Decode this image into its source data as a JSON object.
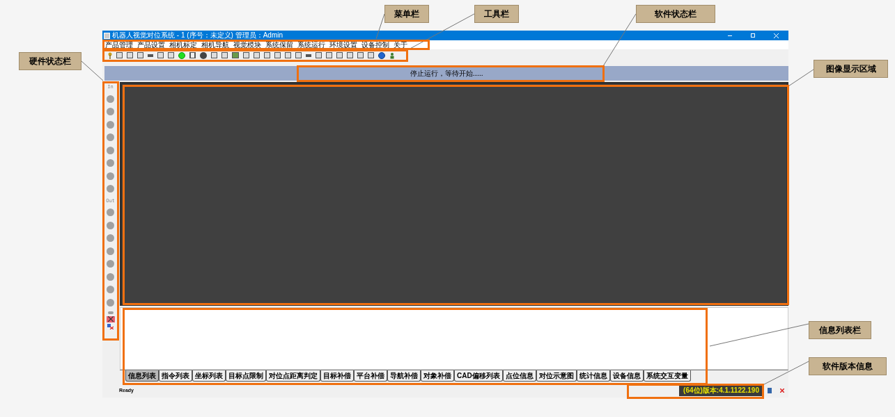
{
  "window": {
    "title": "机器人视觉对位系统 - 1 (序号：未定义) 管理员：Admin"
  },
  "menu": [
    "产品管理",
    "产品设置",
    "相机标定",
    "相机导航",
    "视觉模块",
    "系统保留",
    "系统运行",
    "环境设置",
    "设备控制",
    "关于"
  ],
  "run_status": "停止运行，等待开始......",
  "hardware": {
    "in_label": "In",
    "inputs": [
      {
        "on": false
      },
      {
        "on": false
      },
      {
        "on": false
      },
      {
        "on": false
      },
      {
        "on": false
      },
      {
        "on": false
      },
      {
        "on": false
      },
      {
        "on": false
      }
    ],
    "out_label": "Out",
    "outputs": [
      {
        "on": false
      },
      {
        "on": false
      },
      {
        "on": false
      },
      {
        "on": false
      },
      {
        "on": false
      },
      {
        "on": false
      },
      {
        "on": false
      },
      {
        "on": false
      }
    ]
  },
  "tabs": [
    {
      "label": "信息列表",
      "selected": true
    },
    {
      "label": "指令列表",
      "selected": false
    },
    {
      "label": "坐标列表",
      "selected": false
    },
    {
      "label": "目标点限制",
      "selected": false
    },
    {
      "label": "对位点距离判定",
      "selected": false
    },
    {
      "label": "目标补偿",
      "selected": false
    },
    {
      "label": "平台补偿",
      "selected": false
    },
    {
      "label": "导航补偿",
      "selected": false
    },
    {
      "label": "对象补偿",
      "selected": false
    },
    {
      "label": "CAD偏移列表",
      "selected": false
    },
    {
      "label": "点位信息",
      "selected": false
    },
    {
      "label": "对位示意图",
      "selected": false
    },
    {
      "label": "统计信息",
      "selected": false
    },
    {
      "label": "设备信息",
      "selected": false
    },
    {
      "label": "系统交互变量",
      "selected": false
    }
  ],
  "status_bar": {
    "text": "Ready",
    "version": "(64位)版本:4.1.1122.190"
  },
  "annotations": [
    "菜单栏",
    "工具栏",
    "软件状态栏",
    "硬件状态栏",
    "图像显示区域",
    "信息列表栏",
    "软件版本信息"
  ]
}
